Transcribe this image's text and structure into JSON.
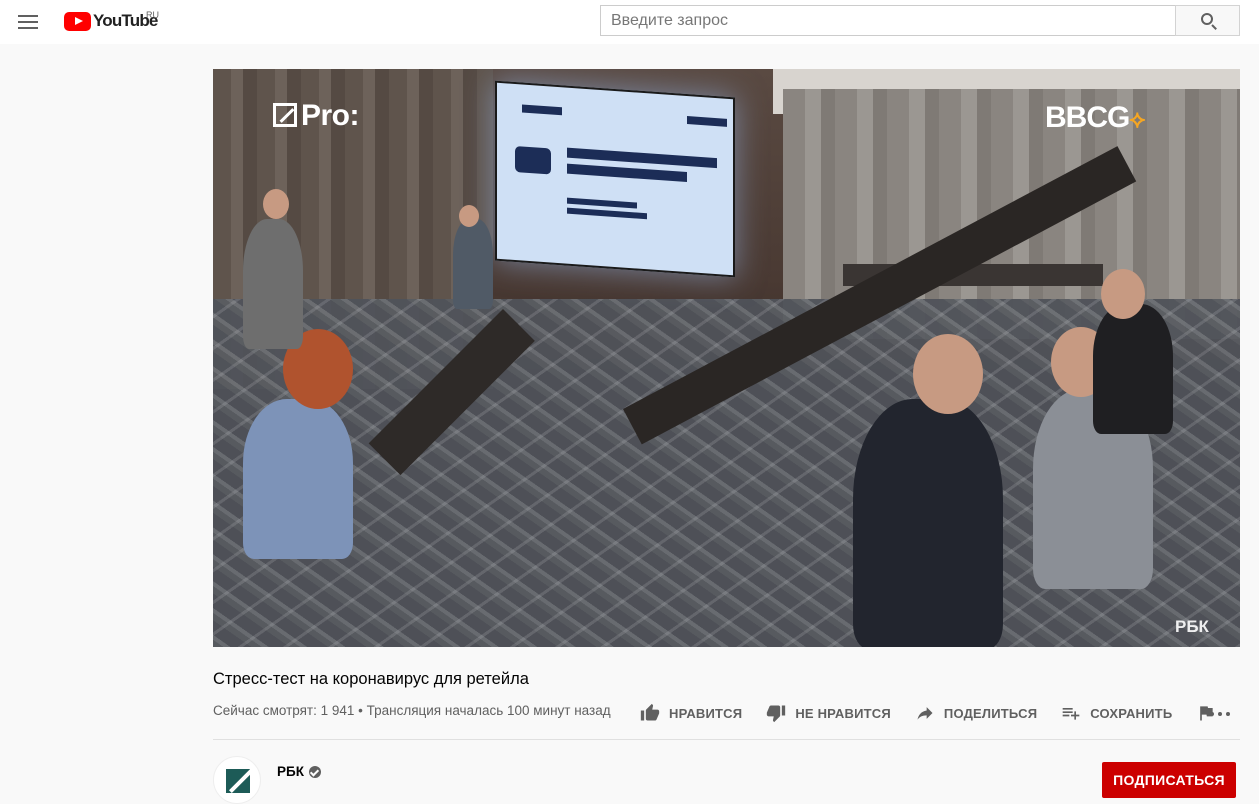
{
  "header": {
    "logo_text": "YouTube",
    "region": "RU",
    "search_placeholder": "Введите запрос"
  },
  "video": {
    "watermark_left": "Pro:",
    "watermark_right": "BBCG",
    "watermark_corner": "РБК",
    "title": "Стресс-тест на коронавирус для ретейла",
    "meta": "Сейчас смотрят: 1 941 • Трансляция началась 100 минут назад"
  },
  "actions": {
    "like": "НРАВИТСЯ",
    "dislike": "НЕ НРАВИТСЯ",
    "share": "ПОДЕЛИТЬСЯ",
    "save": "СОХРАНИТЬ"
  },
  "channel": {
    "name": "РБК",
    "subscribe": "ПОДПИСАТЬСЯ"
  },
  "colors": {
    "brand": "#ff0000",
    "subscribe": "#cc0000",
    "secondary_text": "#606060"
  }
}
